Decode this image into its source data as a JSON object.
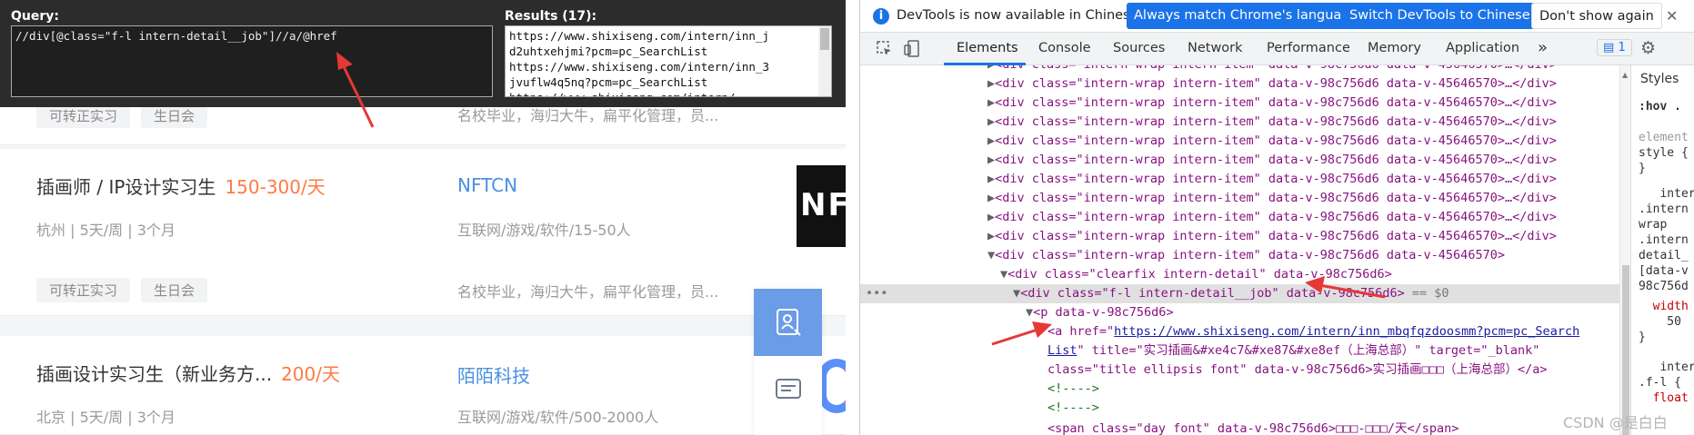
{
  "xpath_helper": {
    "query_label": "Query:",
    "query_value": "//div[@class=\"f-l intern-detail__job\"]//a/@href",
    "results_label": "Results (17):",
    "results": [
      "https://www.shixiseng.com/intern/inn_j",
      "d2uhtxehjmi?pcm=pc_SearchList",
      "https://www.shixiseng.com/intern/inn_3",
      "jvuflw4q5nq?pcm=pc_SearchList",
      "https://www.shixiseng.com/intern/..."
    ]
  },
  "job_cards": [
    {
      "title": "",
      "salary": "",
      "company": "",
      "meta": "",
      "tags": [
        "可转正实习",
        "生日会"
      ],
      "benefits": "名校毕业，海归大牛，扁平化管理，员..."
    },
    {
      "title": "插画师 / IP设计实习生",
      "salary": "150-300/天",
      "company": "NFTCN",
      "meta": "杭州 | 5天/周 | 3个月",
      "industry": "互联网/游戏/软件/15-50人",
      "tags": [
        "可转正实习",
        "生日会"
      ],
      "benefits": "名校毕业，海归大牛，扁平化管理，员..."
    },
    {
      "title": "插画设计实习生（新业务方...",
      "salary": "200/天",
      "company": "陌陌科技",
      "meta": "北京 | 5天/周 | 3个月",
      "industry": "互联网/游戏/软件/500-2000人"
    }
  ],
  "logo_text": "NF",
  "devtools": {
    "info_text": "DevTools is now available in Chinese!",
    "btn_match": "Always match Chrome's language",
    "btn_switch": "Switch DevTools to Chinese",
    "btn_dont": "Don't show again",
    "tabs": [
      "Elements",
      "Console",
      "Sources",
      "Network",
      "Performance",
      "Memory",
      "Application"
    ],
    "more_tabs": "»",
    "issues_count": "1",
    "styles_tab": "Styles",
    "hov_filter": ":hov .",
    "selected_marker": "== $0",
    "watermark": "CSDN @是白白"
  },
  "dom": {
    "wrap_line": "<div class=\"intern-wrap intern-item\" data-v-98c756d6 data-v-45646570>…</div>",
    "wrap_open": "<div class=\"intern-wrap intern-item\" data-v-98c756d6 data-v-45646570>",
    "clearfix": "<div class=\"clearfix intern-detail\" data-v-98c756d6>",
    "job_div": "<div class=\"f-l intern-detail__job\" data-v-98c756d6>",
    "p_open": "<p data-v-98c756d6>",
    "a_href_pre": "<a href=\"",
    "a_href_url": "https://www.shixiseng.com/intern/inn_mbqfqzdoosmm?pcm=pc_Search",
    "a_href_url2": "List",
    "a_title_rest": "\" title=\"实习插画&#xe4c7&#xe87&#xe8ef（上海总部）\" target=\"_blank\"",
    "a_class": "class=\"title ellipsis font\" data-v-98c756d6>实习插画□□□（上海总部）</a>",
    "comment": "<!---->",
    "span_line": "<span class=\"day font\" data-v-98c756d6>□□□-□□□/天</span>"
  },
  "styles_lines": [
    "element",
    "style {",
    "}",
    "   inter",
    ".intern",
    "wrap",
    ".intern",
    "detail_",
    "[data-v",
    "98c756d",
    "  width",
    "    50",
    "}",
    "   inter",
    ".f-l {",
    "  float"
  ]
}
